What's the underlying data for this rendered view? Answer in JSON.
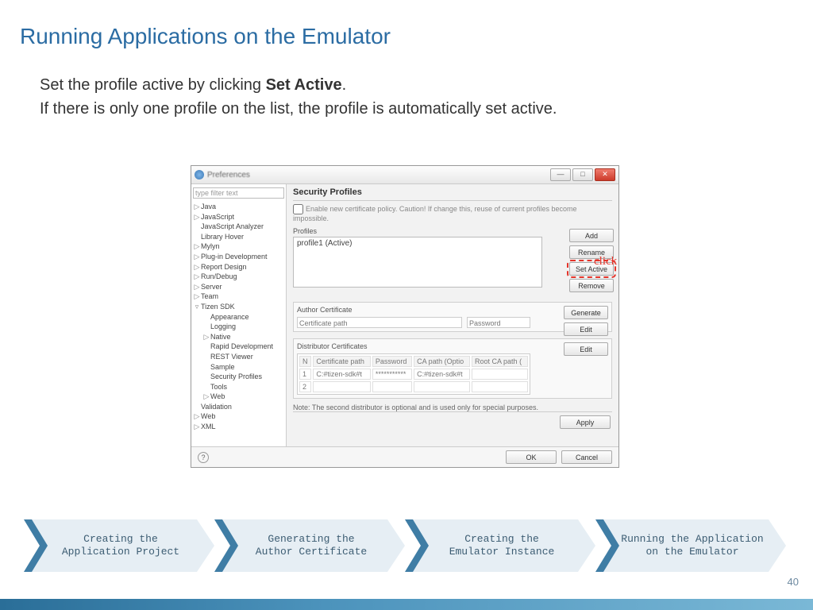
{
  "title": "Running Applications on the Emulator",
  "body": {
    "line1_pre": "Set the profile active by clicking ",
    "line1_bold": "Set Active",
    "line1_post": ".",
    "line2": "If there is only one profile on the list, the profile is automatically set active."
  },
  "annotation": "click",
  "dialog": {
    "window_title": "Preferences",
    "filter_placeholder": "type filter text",
    "tree": [
      {
        "label": "Java",
        "level": 1,
        "exp": "▷"
      },
      {
        "label": "JavaScript",
        "level": 1,
        "exp": "▷"
      },
      {
        "label": "JavaScript Analyzer",
        "level": 1,
        "exp": ""
      },
      {
        "label": "Library Hover",
        "level": 1,
        "exp": ""
      },
      {
        "label": "Mylyn",
        "level": 1,
        "exp": "▷"
      },
      {
        "label": "Plug-in Development",
        "level": 1,
        "exp": "▷"
      },
      {
        "label": "Report Design",
        "level": 1,
        "exp": "▷"
      },
      {
        "label": "Run/Debug",
        "level": 1,
        "exp": "▷"
      },
      {
        "label": "Server",
        "level": 1,
        "exp": "▷"
      },
      {
        "label": "Team",
        "level": 1,
        "exp": "▷"
      },
      {
        "label": "Tizen SDK",
        "level": 1,
        "exp": "▿"
      },
      {
        "label": "Appearance",
        "level": 2,
        "exp": ""
      },
      {
        "label": "Logging",
        "level": 2,
        "exp": ""
      },
      {
        "label": "Native",
        "level": 2,
        "exp": "▷"
      },
      {
        "label": "Rapid Development",
        "level": 2,
        "exp": ""
      },
      {
        "label": "REST Viewer",
        "level": 2,
        "exp": ""
      },
      {
        "label": "Sample",
        "level": 2,
        "exp": ""
      },
      {
        "label": "Security Profiles",
        "level": 2,
        "exp": ""
      },
      {
        "label": "Tools",
        "level": 2,
        "exp": ""
      },
      {
        "label": "Web",
        "level": 2,
        "exp": "▷"
      },
      {
        "label": "Validation",
        "level": 1,
        "exp": ""
      },
      {
        "label": "Web",
        "level": 1,
        "exp": "▷"
      },
      {
        "label": "XML",
        "level": 1,
        "exp": "▷"
      }
    ],
    "main_heading": "Security Profiles",
    "policy_checkbox": "Enable new certificate policy. Caution! If change this, reuse of current profiles become impossible.",
    "profiles_label": "Profiles",
    "profile_item": "profile1 (Active)",
    "buttons": {
      "add": "Add",
      "rename": "Rename",
      "set_active": "Set Active",
      "remove": "Remove",
      "generate": "Generate",
      "edit": "Edit",
      "apply": "Apply",
      "ok": "OK",
      "cancel": "Cancel"
    },
    "author_group": "Author Certificate",
    "author_fields": {
      "path": "Certificate path",
      "pwd": "Password"
    },
    "dist_group": "Distributor Certificates",
    "dist_headers": {
      "n": "N",
      "path": "Certificate path",
      "pwd": "Password",
      "ca": "CA path (Optio",
      "root": "Root CA path ("
    },
    "dist_rows": [
      {
        "n": "1",
        "path": "C:#tizen-sdk#t",
        "pwd": "***********",
        "ca": "C:#tizen-sdk#t",
        "root": ""
      },
      {
        "n": "2",
        "path": "",
        "pwd": "",
        "ca": "",
        "root": ""
      }
    ],
    "note": "Note: The second distributor is optional and is used only for special purposes."
  },
  "process_steps": [
    "Creating the Application Project",
    "Generating the Author Certificate",
    "Creating the Emulator Instance",
    "Running the Application on the Emulator"
  ],
  "page_number": "40",
  "colors": {
    "chev_fill": "#e6eef4",
    "chev_tab": "#3f7da5"
  }
}
